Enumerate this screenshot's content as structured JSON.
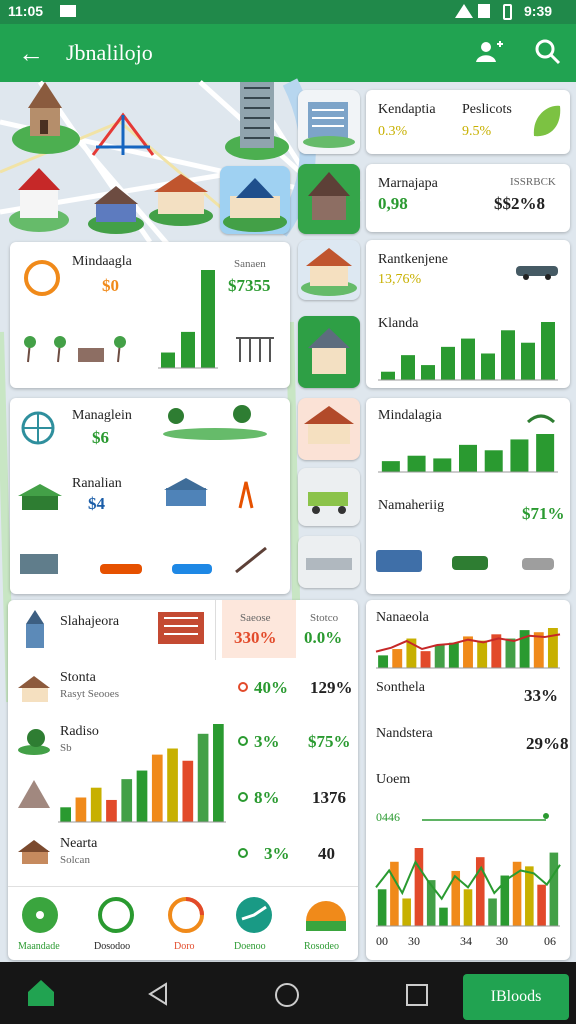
{
  "status": {
    "time": "11:05",
    "right_time": "9:39"
  },
  "app": {
    "title": "Jbnalilojo"
  },
  "cards": {
    "top_right": {
      "a": "Kendaptia",
      "b": "Peslicots",
      "a_val": "0.3%",
      "b_val": "9.5%"
    },
    "mid_right": {
      "a": "Marnajapa",
      "b": "ISSRBCK",
      "a_val": "0,98",
      "b_val": "$$2%8"
    },
    "left1": {
      "a": "Mindaagla",
      "b": "Sanaen",
      "a_val": "$0",
      "b_val": "$7355"
    },
    "right2": {
      "a": "Rantkenjene",
      "a_val": "13,76%",
      "b": "Klanda"
    },
    "left2": {
      "a": "Managlein",
      "a_val": "$6",
      "b": "Ranalian",
      "b_val": "$4"
    },
    "right3": {
      "a": "Mindalagia",
      "b": "Namaheriig",
      "b_val": "$71%"
    },
    "panel": {
      "header": "Slahajeora",
      "tab1": "Saeose",
      "tab1_val": "330%",
      "tab2": "Stotco",
      "tab2_val": "0.0%",
      "rows": [
        {
          "name": "Stonta",
          "sub": "Rasyt Seooes",
          "mid": "40%",
          "right": "129%"
        },
        {
          "name": "Radiso",
          "sub": "Sb",
          "mid": "3%",
          "right": "$75%"
        },
        {
          "name": "",
          "sub": "",
          "mid": "8%",
          "right": "1376"
        },
        {
          "name": "Nearta",
          "sub": "Solcan",
          "mid": "3%",
          "right": "40"
        }
      ]
    },
    "right4": {
      "a": "Nanaeola",
      "b": "Sonthela",
      "b_val": "33%",
      "c": "Nandstera",
      "c_val": "29%8",
      "d": "Uoem",
      "d_val": "0446"
    },
    "bottom_icons": [
      "Maandade",
      "Dosodoo",
      "Doro",
      "Doenoo",
      "Rosodeo"
    ],
    "bottom_chart_labels": [
      "00",
      "30",
      "34",
      "30",
      "06"
    ]
  },
  "nav": {
    "button": "IBloods"
  },
  "chart_data": [
    {
      "type": "bar",
      "values": [
        15,
        35,
        95
      ]
    },
    {
      "type": "bar",
      "values": [
        10,
        30,
        18,
        40,
        50,
        32,
        60,
        45,
        70
      ]
    },
    {
      "type": "bar",
      "values": [
        4,
        6,
        5,
        10,
        8,
        12,
        14
      ]
    },
    {
      "type": "bar",
      "values": [
        12,
        20,
        28,
        18,
        35,
        42,
        55,
        60,
        50,
        72,
        80
      ]
    },
    {
      "type": "bar",
      "values": [
        30,
        45,
        70,
        40,
        55,
        60,
        75,
        65,
        80,
        70,
        90,
        85,
        95
      ]
    },
    {
      "type": "bar",
      "values": [
        40,
        70,
        30,
        85,
        50,
        20,
        60,
        40,
        75,
        30,
        55,
        70,
        65,
        45,
        80
      ]
    }
  ]
}
